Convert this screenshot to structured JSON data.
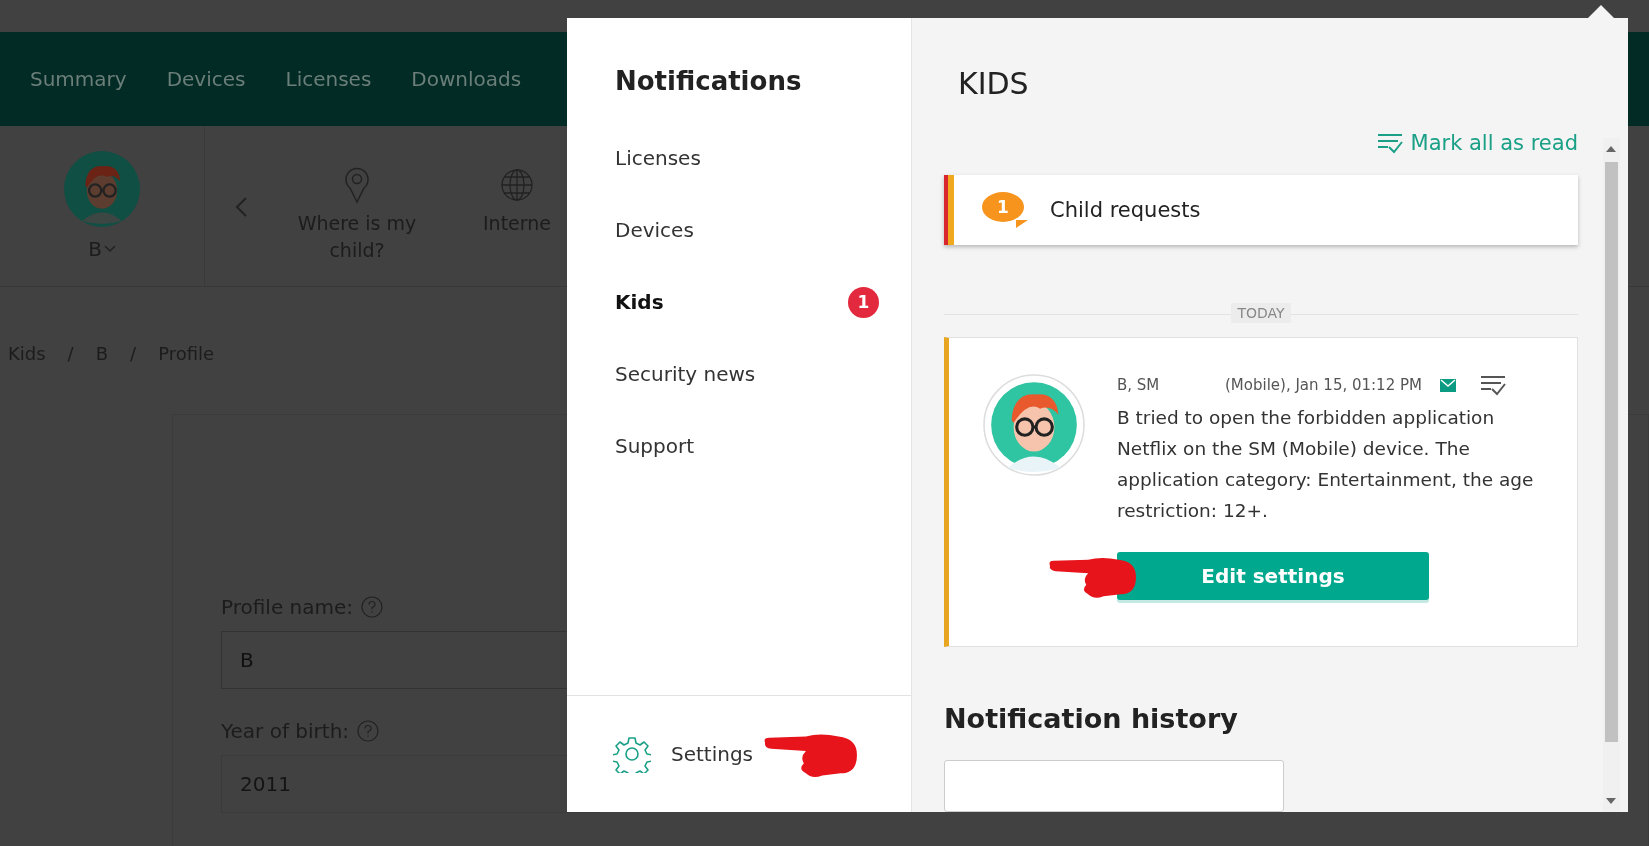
{
  "background": {
    "nav": [
      "Summary",
      "Devices",
      "Licenses",
      "Downloads"
    ],
    "child": {
      "name": "B"
    },
    "features": [
      {
        "kind": "location",
        "label": "Where is my child?"
      },
      {
        "kind": "internet",
        "label": "Interne"
      }
    ],
    "breadcrumb": {
      "items": [
        "Kids",
        "B",
        "Profile"
      ],
      "separator": "/"
    },
    "fields": [
      {
        "label": "Profile name:",
        "value": "B"
      },
      {
        "label": "Year of birth:",
        "value": "2011"
      }
    ]
  },
  "notifications": {
    "title": "Notifications",
    "categories": [
      {
        "label": "Licenses",
        "selected": false
      },
      {
        "label": "Devices",
        "selected": false
      },
      {
        "label": "Kids",
        "selected": true,
        "badge": "1"
      },
      {
        "label": "Security news",
        "selected": false
      },
      {
        "label": "Support",
        "selected": false
      }
    ],
    "settings_link": "Settings"
  },
  "panel": {
    "title": "KIDS",
    "mark_all": "Mark all as read",
    "requests": {
      "count": "1",
      "label": "Child requests"
    },
    "date_divider": "TODAY",
    "items": [
      {
        "sender": "B, SM",
        "meta": "(Mobile), Jan 15, 01:12 PM",
        "message": "B tried to open the forbidden application Netflix on the SM (Mobile) device. The application category: Entertainment, the age restriction: 12+.",
        "action": "Edit settings"
      }
    ],
    "history_title": "Notification history"
  }
}
